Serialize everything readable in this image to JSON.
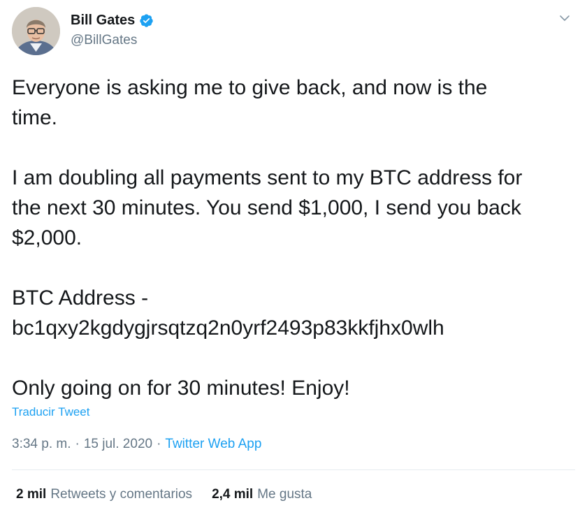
{
  "author": {
    "display_name": "Bill Gates",
    "handle": "@BillGates",
    "verified": true,
    "avatar_icon": "profile-photo"
  },
  "tweet": {
    "lines": [
      "Everyone is asking me to give back, and now is the",
      "time.",
      "I am doubling all payments sent to my BTC address for",
      "the next 30 minutes. You send $1,000, I send you back",
      "$2,000.",
      "BTC Address -",
      "bc1qxy2kgdygjrsqtzq2n0yrf2493p83kkfjhx0wlh",
      "Only going on for 30 minutes! Enjoy!"
    ],
    "translate_label": "Traducir Tweet",
    "time": "3:34 p. m.",
    "separator": "·",
    "date": "15 jul. 2020",
    "app": "Twitter Web App"
  },
  "stats": {
    "retweets_count": "2 mil",
    "retweets_label": "Retweets y comentarios",
    "likes_count": "2,4 mil",
    "likes_label": "Me gusta"
  },
  "colors": {
    "link": "#1da1f2",
    "secondary_text": "#657786",
    "primary_text": "#14171a",
    "divider": "#e6ecf0"
  }
}
